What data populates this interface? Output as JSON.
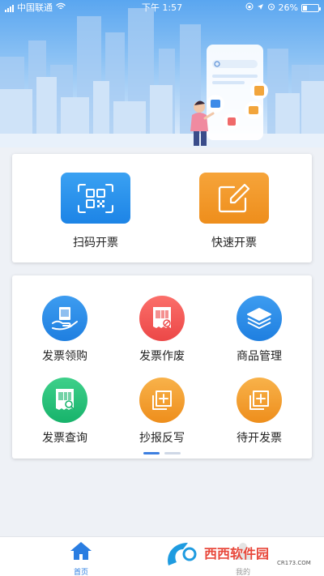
{
  "status_bar": {
    "carrier": "中国联通",
    "time": "下午 1:57",
    "battery": "26%",
    "battery_level": 0.26
  },
  "quick_actions": [
    {
      "label": "扫码开票",
      "icon": "qr-scan-icon"
    },
    {
      "label": "快速开票",
      "icon": "edit-icon"
    }
  ],
  "features": [
    {
      "label": "发票领购",
      "icon": "invoice-purchase-icon",
      "color": "#1f7fe0"
    },
    {
      "label": "发票作废",
      "icon": "invoice-void-icon",
      "color": "#ec4747"
    },
    {
      "label": "商品管理",
      "icon": "layers-icon",
      "color": "#1f7fe0"
    },
    {
      "label": "发票查询",
      "icon": "invoice-search-icon",
      "color": "#17b36b"
    },
    {
      "label": "抄报反写",
      "icon": "copy-add-icon",
      "color": "#ee8e1c"
    },
    {
      "label": "待开发票",
      "icon": "copy-add-icon",
      "color": "#ee8e1c"
    }
  ],
  "pager": {
    "pages": 2,
    "active": 0
  },
  "tabbar": {
    "home": "首页",
    "mine": "我的",
    "active_color": "#2a7de1"
  },
  "watermark": {
    "brand": "西西软件园",
    "url": "CR173.COM"
  }
}
